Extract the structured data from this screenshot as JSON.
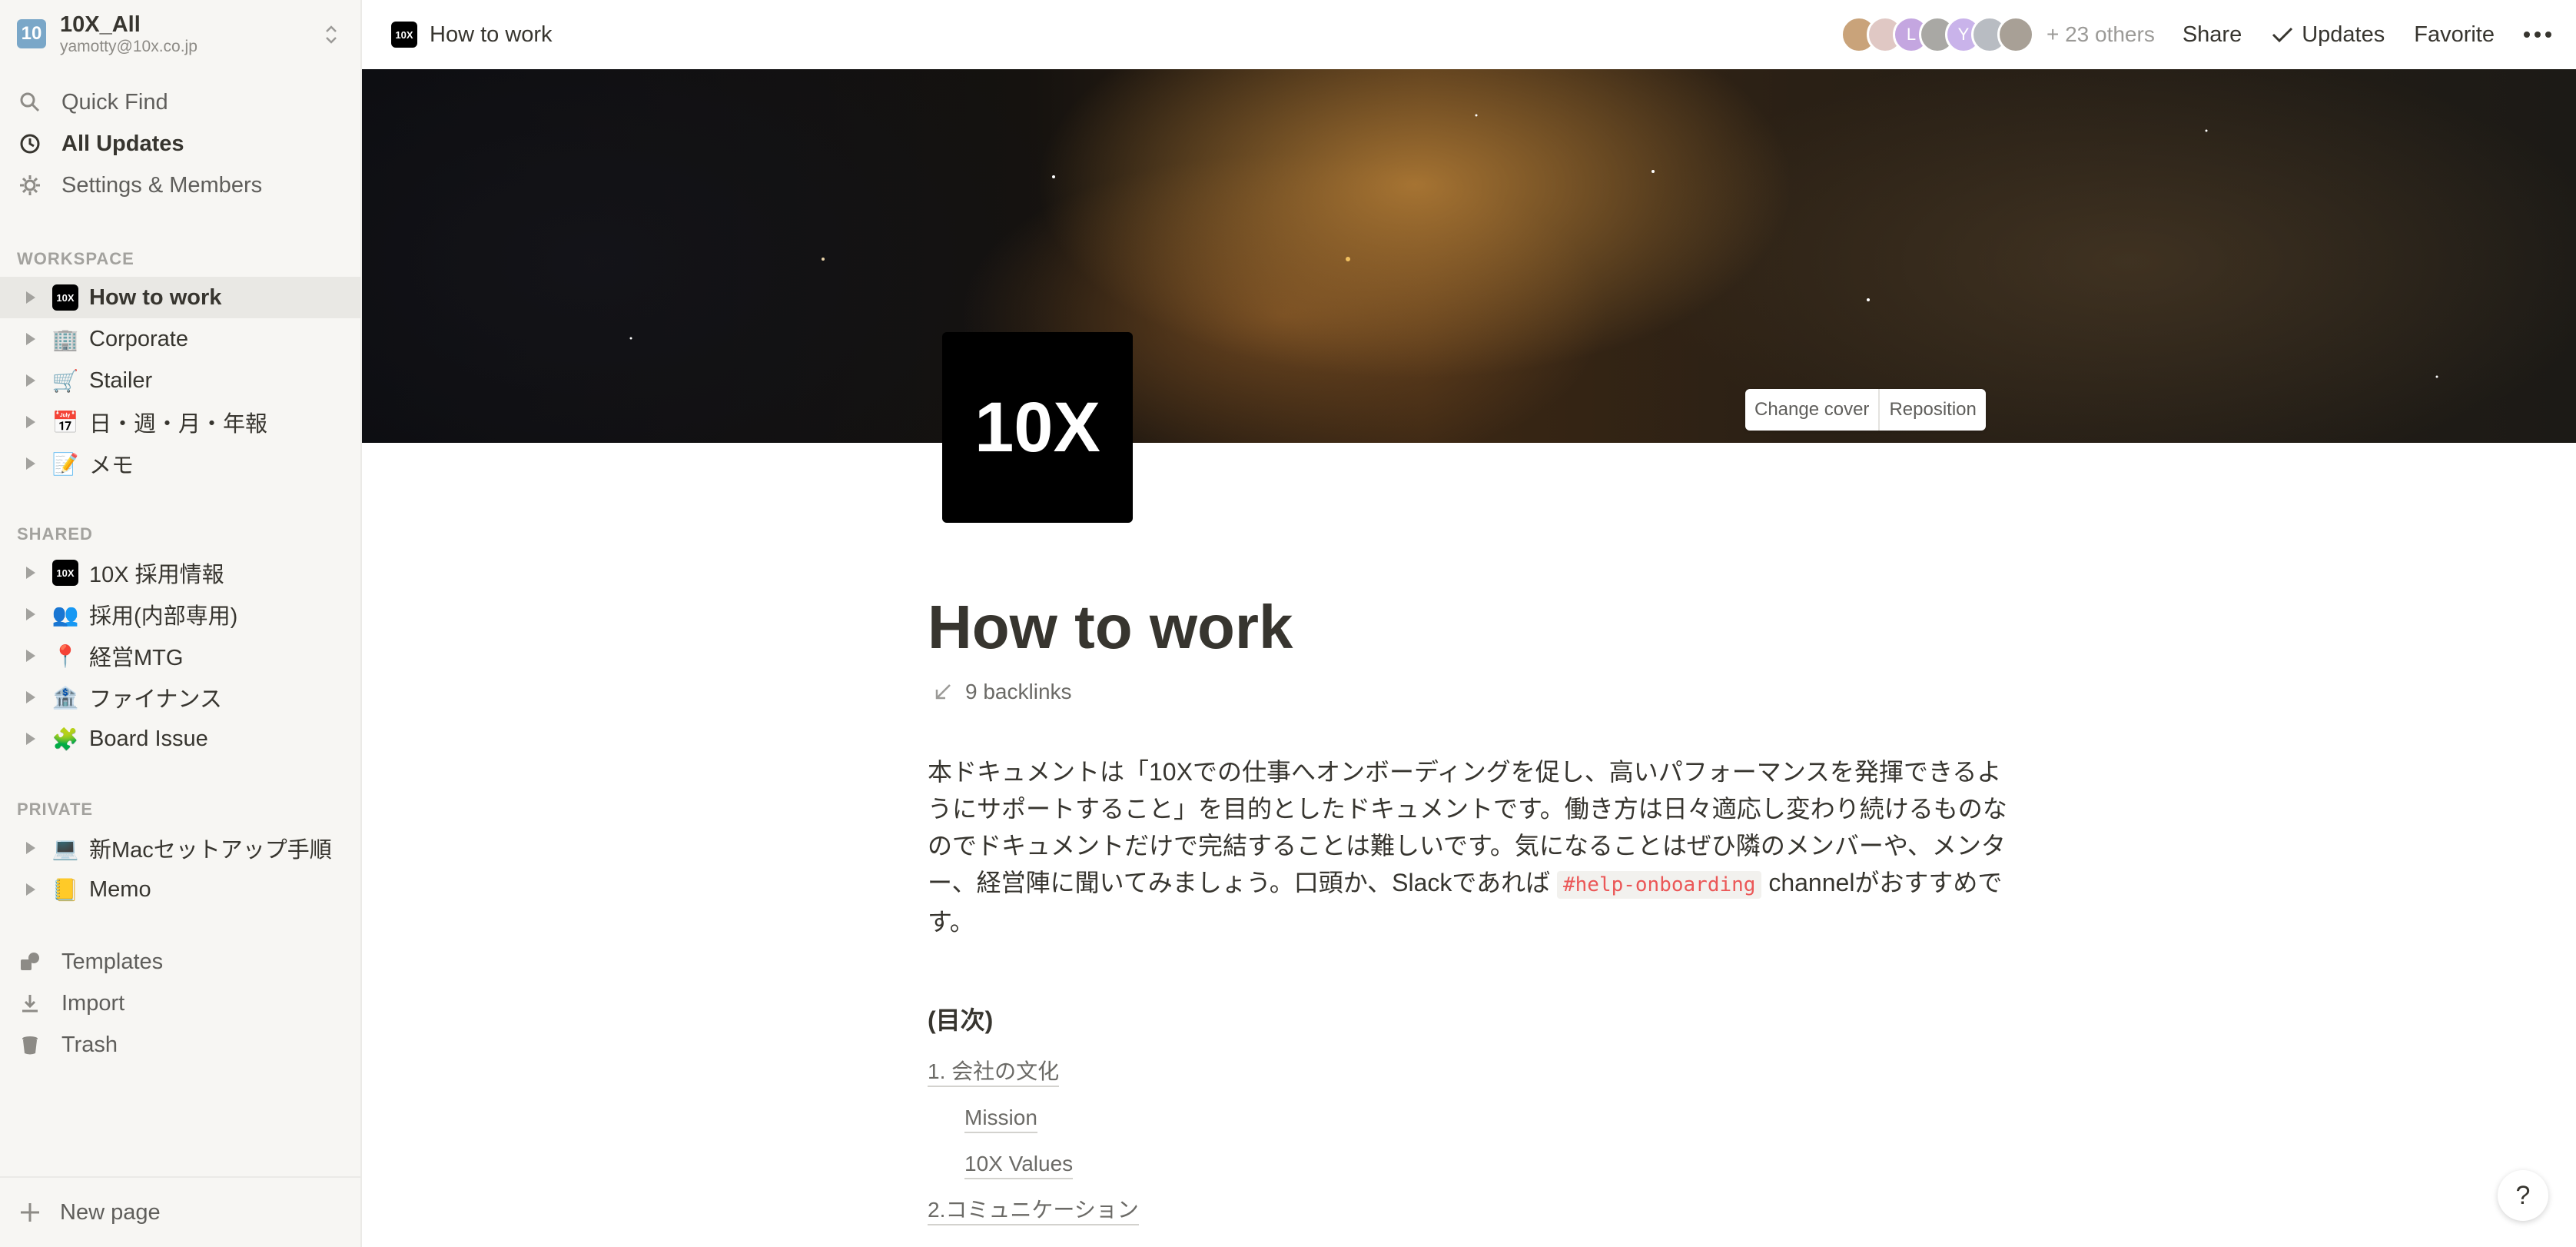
{
  "workspace": {
    "name": "10X_All",
    "email": "yamotty@10x.co.jp",
    "logo_text": "10"
  },
  "sidebar": {
    "top_items": [
      {
        "label": "Quick Find",
        "icon": "search-icon"
      },
      {
        "label": "All Updates",
        "icon": "clock-icon"
      },
      {
        "label": "Settings & Members",
        "icon": "gear-icon"
      }
    ],
    "sections": {
      "workspace": "WORKSPACE",
      "shared": "SHARED",
      "private": "PRIVATE"
    },
    "workspace_pages": [
      {
        "label": "How to work",
        "emoji": "10X"
      },
      {
        "label": "Corporate",
        "emoji": "🏢"
      },
      {
        "label": "Stailer",
        "emoji": "🛒"
      },
      {
        "label": "日・週・月・年報",
        "emoji": "📅"
      },
      {
        "label": "メモ",
        "emoji": "📝"
      }
    ],
    "shared_pages": [
      {
        "label": "10X 採用情報",
        "emoji": "10X"
      },
      {
        "label": "採用(内部専用)",
        "emoji": "👥"
      },
      {
        "label": "経営MTG",
        "emoji": "📍"
      },
      {
        "label": "ファイナンス",
        "emoji": "🏦"
      },
      {
        "label": "Board Issue",
        "emoji": "🧩"
      }
    ],
    "private_pages": [
      {
        "label": "新Macセットアップ手順",
        "emoji": "💻"
      },
      {
        "label": "Memo",
        "emoji": "📒"
      }
    ],
    "bottom_items": [
      {
        "label": "Templates",
        "icon": "templates-icon"
      },
      {
        "label": "Import",
        "icon": "download-icon"
      },
      {
        "label": "Trash",
        "icon": "trash-icon"
      }
    ],
    "new_page": "New page"
  },
  "topbar": {
    "breadcrumb_title": "How to work",
    "badge": "10X",
    "avatar_letters": [
      "",
      "",
      "L",
      "",
      "Y",
      "",
      ""
    ],
    "others": "+ 23 others",
    "share": "Share",
    "updates": "Updates",
    "favorite": "Favorite"
  },
  "cover": {
    "change_cover": "Change cover",
    "reposition": "Reposition"
  },
  "page": {
    "icon_text": "10X",
    "title": "How to work",
    "backlinks": "9 backlinks",
    "intro_before": "本ドキュメントは「10Xでの仕事へオンボーディングを促し、高いパフォーマンスを発揮できるようにサポートすること」を目的としたドキュメントです。働き方は日々適応し変わり続けるものなのでドキュメントだけで完結することは難しいです。気になることはぜひ隣のメンバーや、メンター、経営陣に聞いてみましょう。口頭か、Slackであれば ",
    "intro_code": "#help-onboarding",
    "intro_after": " channelがおすすめです。",
    "toc_heading": "(目次)",
    "toc": [
      {
        "label": "1. 会社の文化",
        "indent": 0
      },
      {
        "label": "Mission",
        "indent": 1
      },
      {
        "label": "10X Values",
        "indent": 1
      },
      {
        "label": "2.コミュニケーション",
        "indent": 0
      }
    ]
  },
  "help": "?"
}
